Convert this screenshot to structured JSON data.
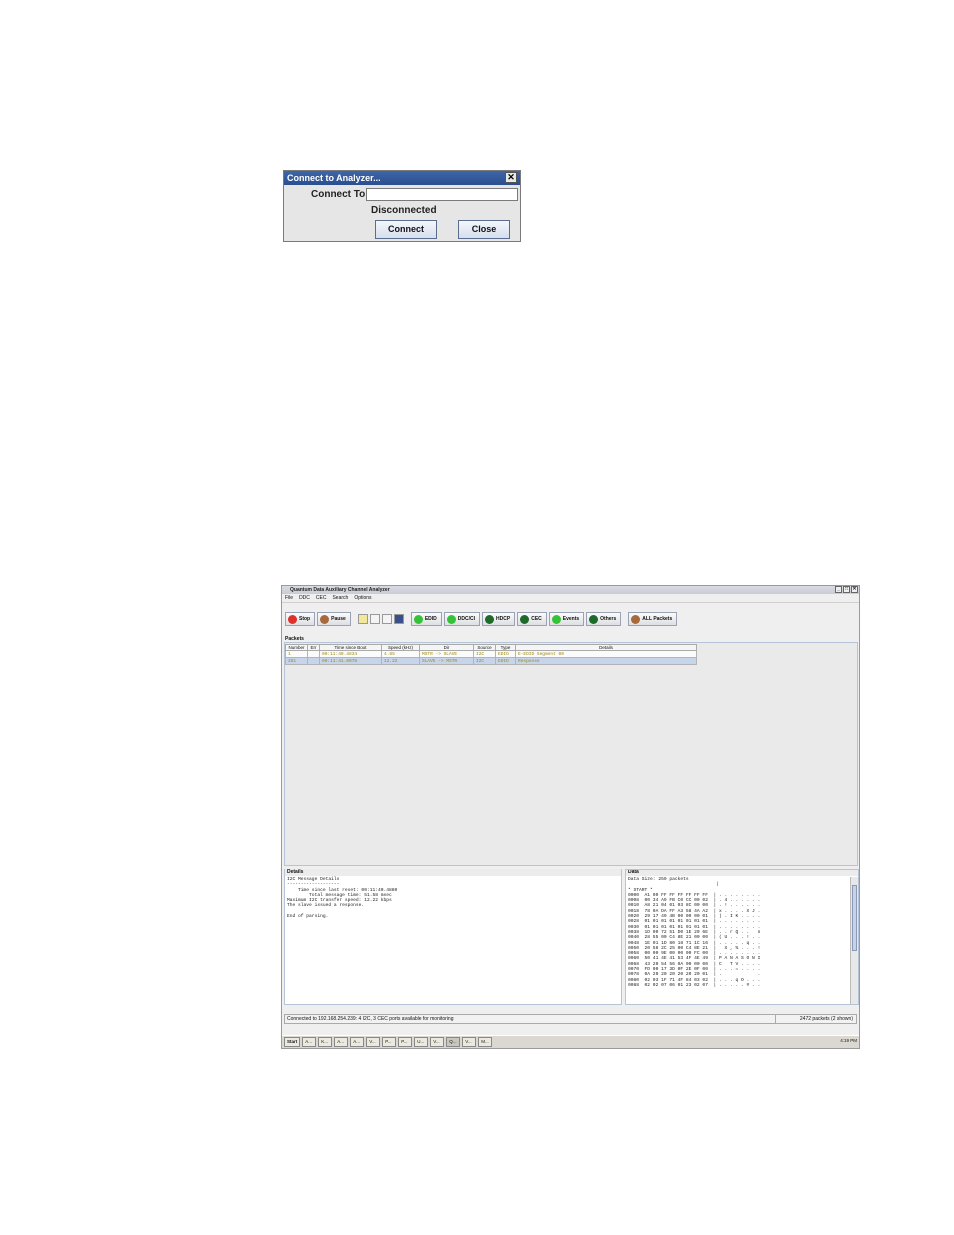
{
  "dialog": {
    "title": "Connect to Analyzer...",
    "close_glyph": "✕",
    "connect_to_label": "Connect To:",
    "connect_to_value": "",
    "status": "Disconnected",
    "connect_button": "Connect",
    "close_button": "Close"
  },
  "app": {
    "title": "Quantum Data Auxiliary Channel Analyzer",
    "window_buttons": [
      "_",
      "□",
      "✕"
    ],
    "menu": [
      "File",
      "DDC",
      "CEC",
      "Search",
      "Options"
    ],
    "toolbar": {
      "stop": "Stop",
      "pause": "Pause",
      "edid": "EDID",
      "ddcci": "DDC/CI",
      "hdcp": "HDCP",
      "cec": "CEC",
      "events": "Events",
      "others": "Others",
      "all_packets": "ALL Packets"
    },
    "packets": {
      "label": "Packets",
      "columns": [
        "Number",
        "Err",
        "Time since Boot",
        "Speed (kHz)",
        "Dir",
        "Source",
        "Type",
        "Details"
      ],
      "rows": [
        [
          "1",
          "",
          "00:11:40.4834",
          "4.85",
          "MSTR -> SLAVE",
          "I2C",
          "EDID",
          "E-EDID Segment 00"
        ],
        [
          "261",
          "",
          "00:11:41.0078",
          "12.22",
          "SLAVE -> MSTR",
          "I2C",
          "EDID",
          "Response"
        ]
      ]
    },
    "details": {
      "label": "Details",
      "text": "I2C Message Details\n-------------------\n    Time since last reset: 00:11:40.4880\n        Total message time: 51.58 msec\nMaximum I2C transfer speed: 12.22 kbps\nThe slave issued a response.\n\nEnd of parsing."
    },
    "data": {
      "label": "Data",
      "text": "Data Size: 259 packets\n                                |\n* START *\n0000  A1 00 FF FF FF FF FF FF  | . . . . . . . .\n0008  00 34 A9 FB C0 CC 00 02  | . 4 . . . . . .\n0010  A8 21 04 01 03 8C 00 00  | . ! . . . . . .\n0018  78 0A DA FF A3 58 4A A2  | x . . . . X J .\n0020  29 17 49 4B 00 00 00 01  | ) . I K . . . .\n0028  01 01 01 01 01 01 01 01  | . . . . . . . .\n0030  01 01 01 01 01 01 01 01  | . . . . . . . .\n0038  1D 00 72 51 D0 1E 20 6E  | . . r Q . .   n\n0040  28 55 00 C4 8E 21 00 00  | ( U . . . ! . .\n0048  1E 01 1D 80 18 71 1C 16  | . . . . . q . .\n0050  20 58 2C 25 00 C4 8E 21  |   X , % . . . !\n0058  00 00 9E 00 00 00 FC 00  | . . . . . . . .\n0060  50 41 4E 41 53 4F 4E 49  | P A N A S O N I\n0068  43 20 54 56 0A 00 00 00  | C   T V . . . .\n0070  FD 00 17 3D 0F 2E 0F 00  | . . . = . . . .\n0078  0A 20 20 20 20 20 20 01  | .             .\n0080  02 03 1F 71 4F 84 03 02  | . . . q O . . .\n0088  02 02 07 06 01 23 02 07  | . . . . . # . ."
    },
    "status": {
      "left": "Connected to 192.168.254.239: 4 I2C, 3 CEC ports available for monitoring",
      "right": "2472 packets (2 shown)"
    },
    "taskbar": {
      "start": "Start",
      "items": [
        "A...",
        "K...",
        "A...",
        "A...",
        "V...",
        "P...",
        "P...",
        "U...",
        "V...",
        "Q...",
        "V...",
        "M..."
      ],
      "clock": "4:19 PM"
    }
  },
  "colors": {
    "title_blue": "#2a4f8f",
    "stop_red": "#e0302a",
    "pause_brown": "#a86a3c",
    "green_on": "#36c236",
    "green_dark": "#1d6a2a",
    "row_text": "#9a8a10",
    "row_selected": "#c6d4ec"
  }
}
